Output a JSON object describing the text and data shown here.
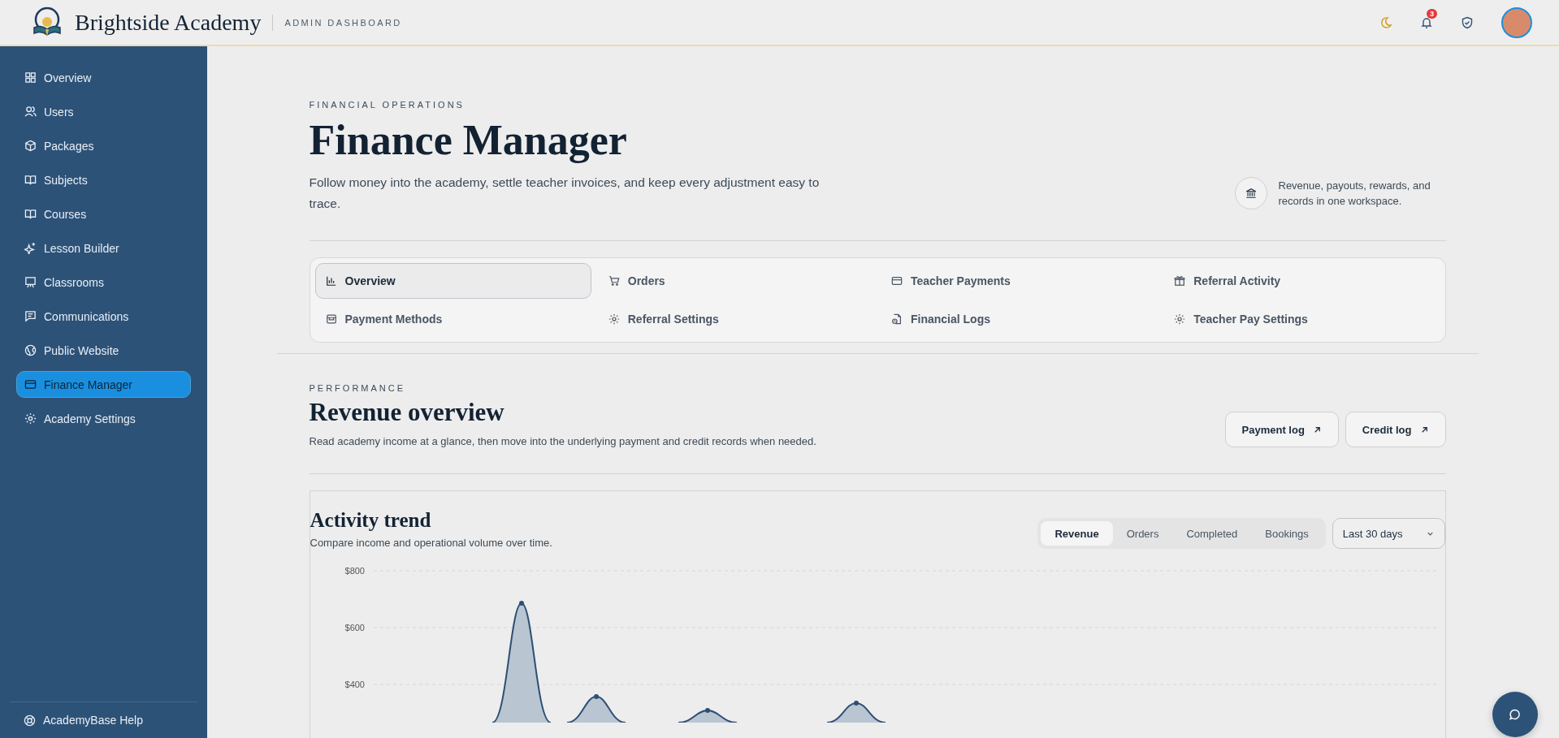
{
  "header": {
    "brand": "Brightside Academy",
    "subtitle": "ADMIN DASHBOARD",
    "notification_count": "3"
  },
  "sidebar": {
    "items": [
      {
        "label": "Overview",
        "selected": false
      },
      {
        "label": "Users",
        "selected": false
      },
      {
        "label": "Packages",
        "selected": false
      },
      {
        "label": "Subjects",
        "selected": false
      },
      {
        "label": "Courses",
        "selected": false
      },
      {
        "label": "Lesson Builder",
        "selected": false
      },
      {
        "label": "Classrooms",
        "selected": false
      },
      {
        "label": "Communications",
        "selected": false
      },
      {
        "label": "Public Website",
        "selected": false
      },
      {
        "label": "Finance Manager",
        "selected": true
      },
      {
        "label": "Academy Settings",
        "selected": false
      }
    ],
    "help": "AcademyBase Help"
  },
  "page": {
    "eyebrow": "FINANCIAL OPERATIONS",
    "title": "Finance Manager",
    "description": "Follow money into the academy, settle teacher invoices, and keep every adjustment easy to trace.",
    "aside": "Revenue, payouts, rewards, and records in one workspace."
  },
  "tabs": [
    {
      "label": "Overview",
      "selected": true
    },
    {
      "label": "Orders",
      "selected": false
    },
    {
      "label": "Teacher Payments",
      "selected": false
    },
    {
      "label": "Referral Activity",
      "selected": false
    },
    {
      "label": "Payment Methods",
      "selected": false
    },
    {
      "label": "Referral Settings",
      "selected": false
    },
    {
      "label": "Financial Logs",
      "selected": false
    },
    {
      "label": "Teacher Pay Settings",
      "selected": false
    }
  ],
  "performance": {
    "eyebrow": "PERFORMANCE",
    "title": "Revenue overview",
    "description": "Read academy income at a glance, then move into the underlying payment and credit records when needed.",
    "buttons": [
      "Payment log",
      "Credit log"
    ]
  },
  "activity": {
    "title": "Activity trend",
    "subtitle": "Compare income and operational volume over time.",
    "metrics": [
      {
        "label": "Revenue",
        "selected": true
      },
      {
        "label": "Orders",
        "selected": false
      },
      {
        "label": "Completed",
        "selected": false
      },
      {
        "label": "Bookings",
        "selected": false
      }
    ],
    "range": "Last 30 days",
    "y_labels": [
      "$800",
      "$600",
      "$400"
    ]
  }
}
